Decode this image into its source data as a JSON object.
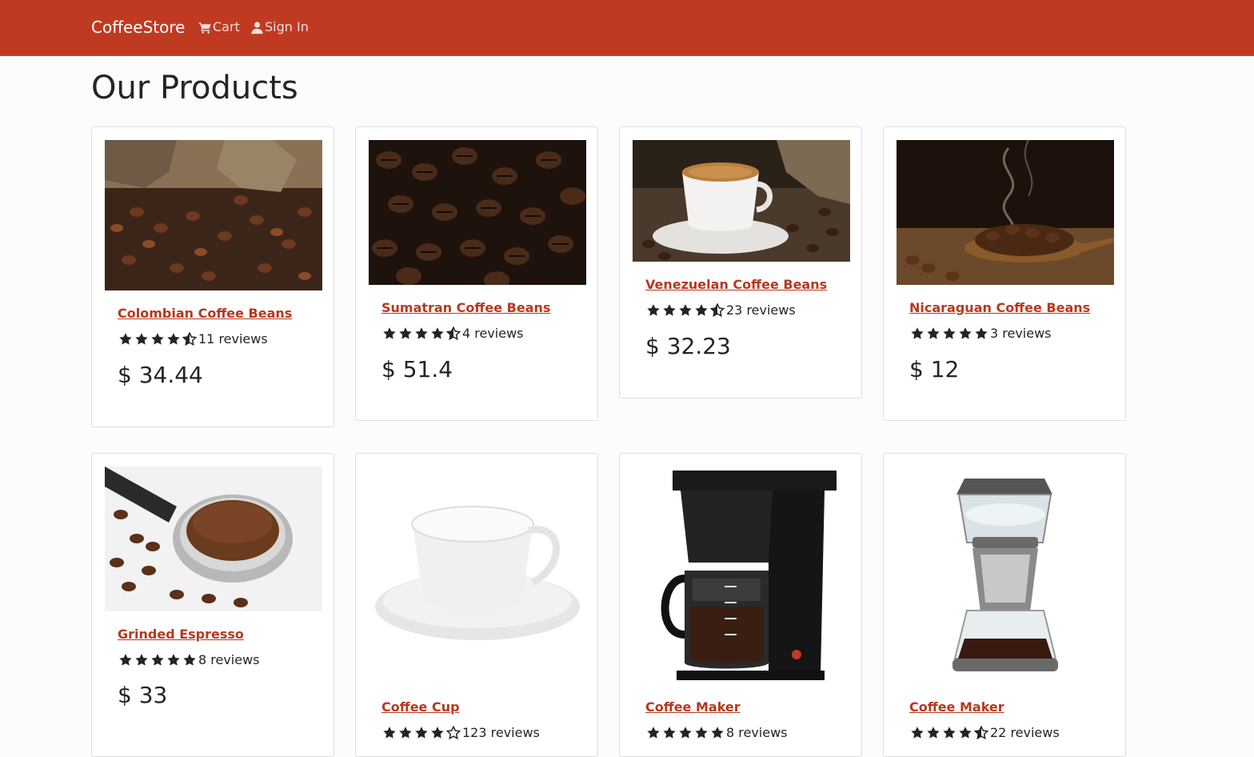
{
  "nav": {
    "brand": "CoffeeStore",
    "cart_label": "Cart",
    "signin_label": "Sign In",
    "cart_icon": "cart-icon",
    "signin_icon": "user-icon",
    "background_color": "#c03a22"
  },
  "page": {
    "title": "Our Products"
  },
  "link_color": "#b7381f",
  "products": [
    {
      "name": "Colombian Coffee Beans",
      "rating": 4.5,
      "reviews": "11 reviews",
      "price": "$ 34.44",
      "image": "coffee-beans-sack-image"
    },
    {
      "name": "Sumatran Coffee Beans",
      "rating": 4.5,
      "reviews": "4 reviews",
      "price": "$ 51.4",
      "image": "roasted-coffee-beans-image"
    },
    {
      "name": "Venezuelan Coffee Beans",
      "rating": 4.5,
      "reviews": "23 reviews",
      "price": "$ 32.23",
      "image": "espresso-cup-image"
    },
    {
      "name": "Nicaraguan Coffee Beans",
      "rating": 5,
      "reviews": "3 reviews",
      "price": "$ 12",
      "image": "steaming-beans-spoon-image"
    },
    {
      "name": "Grinded Espresso",
      "rating": 5,
      "reviews": "8 reviews",
      "price": "$ 33",
      "image": "portafilter-ground-coffee-image"
    },
    {
      "name": "Coffee Cup",
      "rating": 4,
      "reviews": "123 reviews",
      "price": "",
      "image": "white-coffee-cup-image"
    },
    {
      "name": "Coffee Maker",
      "rating": 5,
      "reviews": "8 reviews",
      "price": "",
      "image": "black-coffee-maker-image"
    },
    {
      "name": "Coffee Maker",
      "rating": 4.5,
      "reviews": "22 reviews",
      "price": "",
      "image": "glass-coffee-maker-image"
    }
  ]
}
